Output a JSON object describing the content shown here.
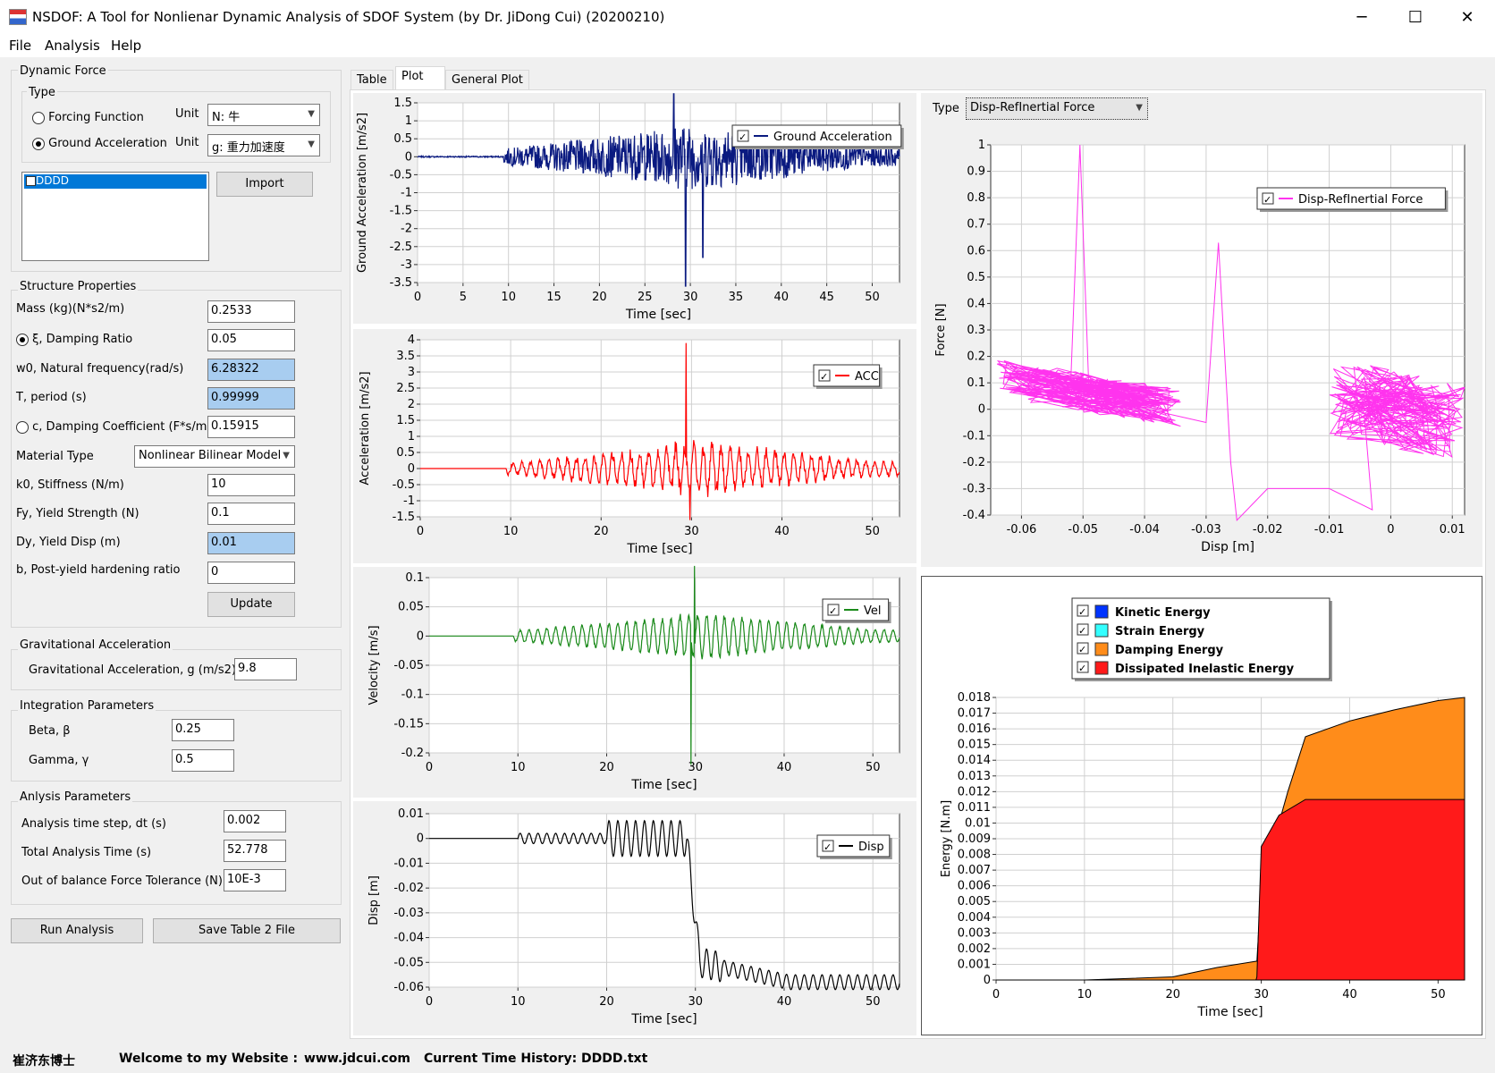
{
  "window": {
    "title": "NSDOF: A Tool for Nonlienar Dynamic Analysis of SDOF System (by Dr. JiDong Cui) (20200210)",
    "minimize": "─",
    "maximize": "☐",
    "close": "✕"
  },
  "menu": [
    "File",
    "Analysis",
    "Help"
  ],
  "dynamic_force": {
    "group": "Dynamic Force",
    "type_group": "Type",
    "forcing_function": "Forcing Function",
    "ground_acceleration": "Ground Acceleration",
    "unit_label": "Unit",
    "unit1": "N: 牛",
    "unit2": "g: 重力加速度",
    "list_item": "DDDD",
    "import": "Import"
  },
  "structure": {
    "group": "Structure Properties",
    "rows": [
      {
        "label": "Mass (kg)(N*s2/m)",
        "value": "0.2533"
      },
      {
        "label": "ξ, Damping Ratio",
        "value": "0.05"
      },
      {
        "label": "w0, Natural frequency(rad/s)",
        "value": "6.28322"
      },
      {
        "label": "T, period (s)",
        "value": "0.99999"
      },
      {
        "label": "c, Damping Coefficient (F*s/m)",
        "value": "0.15915"
      },
      {
        "label": "Material Type",
        "value": "Nonlinear Bilinear Model"
      },
      {
        "label": "k0, Stiffness (N/m)",
        "value": "10"
      },
      {
        "label": "Fy, Yield Strength (N)",
        "value": "0.1"
      },
      {
        "label": "Dy, Yield Disp (m)",
        "value": "0.01"
      },
      {
        "label": "b, Post-yield hardening ratio",
        "value": "0"
      }
    ],
    "update": "Update"
  },
  "gravity": {
    "group": "Gravitational Acceleration",
    "label": "Gravitational Acceleration, g (m/s2)",
    "value": "9.8"
  },
  "integration": {
    "group": "Integration Parameters",
    "beta_label": "Beta, β",
    "beta": "0.25",
    "gamma_label": "Gamma, γ",
    "gamma": "0.5"
  },
  "analysis": {
    "group": "Anlysis  Parameters",
    "dt_label": "Analysis time step, dt (s)",
    "dt": "0.002",
    "total_label": "Total Analysis Time (s)",
    "total": "52.778",
    "tol_label": "Out of balance Force Tolerance (N)",
    "tol": "10E-3"
  },
  "buttons": {
    "run": "Run Analysis",
    "save": "Save Table 2 File"
  },
  "tabs": [
    "Table",
    "Plot",
    "General Plot"
  ],
  "right": {
    "type_label": "Type",
    "type_value": "Disp-RefInertial Force"
  },
  "status": {
    "name": "崔济东博士",
    "welcome": "Welcome to my Website :",
    "url": "www.jdcui.com",
    "current": "Current Time History: DDDD.txt"
  },
  "colors": {
    "ground": "#0a1a80",
    "acc": "#ff0000",
    "vel": "#1a8a1a",
    "disp": "#000000",
    "hyst": "#ff33ee",
    "kinetic": "#0033ff",
    "strain": "#33ffff",
    "damping": "#ff8c1a",
    "dissipated": "#ff1a1a"
  },
  "chart_data": [
    {
      "type": "line",
      "title": "",
      "xlabel": "Time [sec]",
      "ylabel": "Ground Acceleration [m/s2]",
      "xlim": [
        0,
        53
      ],
      "ylim": [
        -3.5,
        1.5
      ],
      "xticks": [
        "0",
        "5",
        "10",
        "15",
        "20",
        "25",
        "30",
        "35",
        "40",
        "45",
        "50"
      ],
      "yticks": [
        "1.5",
        "1",
        "0.5",
        "0",
        "-0.5",
        "-1",
        "-1.5",
        "-2",
        "-2.5",
        "-3",
        "-3.5"
      ],
      "series": [
        {
          "name": "Ground Acceleration",
          "peak_max": 1.75,
          "peak_min": -3.6
        }
      ],
      "grid": true,
      "legend": "top-right"
    },
    {
      "type": "line",
      "xlabel": "Time [sec]",
      "ylabel": "Acceleration [m/s2]",
      "xlim": [
        0,
        53
      ],
      "ylim": [
        -1.5,
        4
      ],
      "xticks": [
        "0",
        "10",
        "20",
        "30",
        "40",
        "50"
      ],
      "yticks": [
        "4",
        "3.5",
        "3",
        "2.5",
        "2",
        "1.5",
        "1",
        "0.5",
        "0",
        "-0.5",
        "-1",
        "-1.5"
      ],
      "series": [
        {
          "name": "ACC",
          "peak_max": 3.9,
          "peak_min": -1.6
        }
      ],
      "grid": true,
      "legend": "top-right"
    },
    {
      "type": "line",
      "xlabel": "Time [sec]",
      "ylabel": "Velocity [m/s]",
      "xlim": [
        0,
        53
      ],
      "ylim": [
        -0.2,
        0.1
      ],
      "xticks": [
        "0",
        "10",
        "20",
        "30",
        "40",
        "50"
      ],
      "yticks": [
        "0.1",
        "0.05",
        "0",
        "-0.05",
        "-0.1",
        "-0.15",
        "-0.2"
      ],
      "series": [
        {
          "name": "Vel",
          "peak_max": 0.12,
          "peak_min": -0.22
        }
      ],
      "grid": true,
      "legend": "top-right"
    },
    {
      "type": "line",
      "xlabel": "Time [sec]",
      "ylabel": "Disp [m]",
      "xlim": [
        0,
        53
      ],
      "ylim": [
        -0.06,
        0.01
      ],
      "xticks": [
        "0",
        "10",
        "20",
        "30",
        "40",
        "50"
      ],
      "yticks": [
        "0.01",
        "0",
        "-0.01",
        "-0.02",
        "-0.03",
        "-0.04",
        "-0.05",
        "-0.06"
      ],
      "series": [
        {
          "name": "Disp",
          "final": -0.058
        }
      ],
      "grid": true,
      "legend": "top-right"
    },
    {
      "type": "line",
      "xlabel": "Disp [m]",
      "ylabel": "Force [N]",
      "xlim": [
        -0.065,
        0.012
      ],
      "ylim": [
        -0.4,
        1
      ],
      "xticks": [
        "-0.06",
        "-0.05",
        "-0.04",
        "-0.03",
        "-0.02",
        "-0.01",
        "0",
        "0.01"
      ],
      "yticks": [
        "1",
        "0.9",
        "0.8",
        "0.7",
        "0.6",
        "0.5",
        "0.4",
        "0.3",
        "0.2",
        "0.1",
        "0",
        "-0.1",
        "-0.2",
        "-0.3",
        "-0.4"
      ],
      "series": [
        {
          "name": "Disp-RefInertial Force",
          "peak_max": 1.0,
          "peak_min": -0.42
        }
      ],
      "grid": true,
      "legend": "top-right"
    },
    {
      "type": "area",
      "xlabel": "Time [sec]",
      "ylabel": "Energy [N.m]",
      "xlim": [
        0,
        53
      ],
      "ylim": [
        0,
        0.018
      ],
      "xticks": [
        "0",
        "10",
        "20",
        "30",
        "40",
        "50"
      ],
      "yticks": [
        "0.018",
        "0.017",
        "0.016",
        "0.015",
        "0.014",
        "0.013",
        "0.012",
        "0.011",
        "0.01",
        "0.009",
        "0.008",
        "0.007",
        "0.006",
        "0.005",
        "0.004",
        "0.003",
        "0.002",
        "0.001",
        "0"
      ],
      "series": [
        {
          "name": "Kinetic Energy"
        },
        {
          "name": "Strain Energy"
        },
        {
          "name": "Damping Energy",
          "x": [
            0,
            10,
            20,
            25,
            29.5,
            30,
            33,
            35,
            40,
            45,
            50,
            53
          ],
          "y": [
            0,
            0,
            0.0002,
            0.0008,
            0.0012,
            0.006,
            0.012,
            0.0155,
            0.0165,
            0.0172,
            0.0178,
            0.018
          ]
        },
        {
          "name": "Dissipated Inelastic Energy",
          "x": [
            0,
            29.4,
            29.5,
            30,
            32,
            35,
            53
          ],
          "y": [
            0,
            0,
            0.0002,
            0.0085,
            0.0105,
            0.0115,
            0.0115
          ]
        }
      ],
      "grid": true,
      "legend": "top-left"
    }
  ]
}
